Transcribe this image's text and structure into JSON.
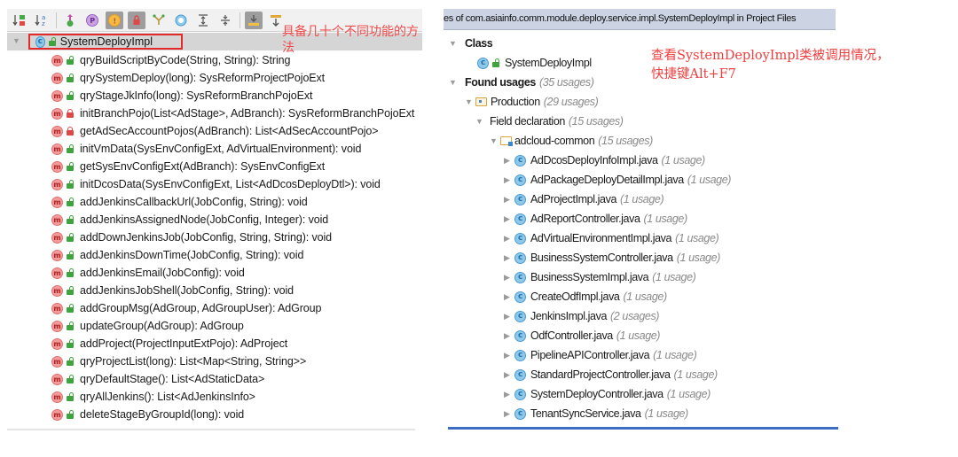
{
  "structure_panel": {
    "toolbar": [
      {
        "icon": "sort-by-visibility-icon",
        "glyph": "↓",
        "pressed": false
      },
      {
        "icon": "sort-alphabetically-icon",
        "glyph": "↓",
        "pressed": false
      },
      {
        "icon": "show-inherited-icon",
        "glyph": "↑",
        "pressed": false
      },
      {
        "icon": "show-properties-icon",
        "glyph": "P",
        "pressed": false
      },
      {
        "icon": "show-fields-icon",
        "glyph": "f",
        "pressed": true
      },
      {
        "icon": "show-non-public-icon",
        "glyph": "a",
        "pressed": true
      },
      {
        "icon": "show-lambdas-icon",
        "glyph": "Y",
        "pressed": false
      },
      {
        "icon": "show-anonymous-classes-icon",
        "glyph": "○",
        "pressed": false
      },
      {
        "icon": "expand-all-icon",
        "glyph": "≡",
        "pressed": false
      },
      {
        "icon": "collapse-all-icon",
        "glyph": "≑",
        "pressed": false
      },
      {
        "icon": "autoscroll-to-source-icon",
        "glyph": "⤓",
        "pressed": true
      },
      {
        "icon": "autoscroll-from-source-icon",
        "glyph": "⤒",
        "pressed": false
      }
    ],
    "root": {
      "label": "SystemDeployImpl",
      "kind": "class",
      "access": "public"
    },
    "methods": [
      {
        "label": "qryBuildScriptByCode(String, String): String",
        "access": "public"
      },
      {
        "label": "qrySystemDeploy(long): SysReformProjectPojoExt",
        "access": "public"
      },
      {
        "label": "qryStageJkInfo(long): SysReformBranchPojoExt",
        "access": "public"
      },
      {
        "label": "initBranchPojo(List<AdStage>, AdBranch): SysReformBranchPojoExt",
        "access": "private"
      },
      {
        "label": "getAdSecAccountPojos(AdBranch): List<AdSecAccountPojo>",
        "access": "private"
      },
      {
        "label": "initVmData(SysEnvConfigExt, AdVirtualEnvironment): void",
        "access": "public"
      },
      {
        "label": "getSysEnvConfigExt(AdBranch): SysEnvConfigExt",
        "access": "public"
      },
      {
        "label": "initDcosData(SysEnvConfigExt, List<AdDcosDeployDtl>): void",
        "access": "public"
      },
      {
        "label": "addJenkinsCallbackUrl(JobConfig, String): void",
        "access": "public"
      },
      {
        "label": "addJenkinsAssignedNode(JobConfig, Integer): void",
        "access": "public"
      },
      {
        "label": "addDownJenkinsJob(JobConfig, String, String): void",
        "access": "public"
      },
      {
        "label": "addJenkinsDownTime(JobConfig, String): void",
        "access": "public"
      },
      {
        "label": "addJenkinsEmail(JobConfig): void",
        "access": "public"
      },
      {
        "label": "addJenkinsJobShell(JobConfig, String): void",
        "access": "public"
      },
      {
        "label": "addGroupMsg(AdGroup, AdGroupUser): AdGroup",
        "access": "public"
      },
      {
        "label": "updateGroup(AdGroup): AdGroup",
        "access": "public"
      },
      {
        "label": "addProject(ProjectInputExtPojo): AdProject",
        "access": "public"
      },
      {
        "label": "qryProjectList(long): List<Map<String, String>>",
        "access": "public"
      },
      {
        "label": "qryDefaultStage(): List<AdStaticData>",
        "access": "public"
      },
      {
        "label": "qryAllJenkins(): List<AdJenkinsInfo>",
        "access": "public"
      },
      {
        "label": "deleteStageByGroupId(long): void",
        "access": "public"
      }
    ],
    "annotation": "具备几十个不同功能的方法"
  },
  "usages_panel": {
    "header": "es of com.asiainfo.comm.module.deploy.service.impl.SystemDeployImpl in Project Files",
    "class_group": {
      "label": "Class",
      "item": "SystemDeployImpl"
    },
    "found": {
      "label": "Found usages",
      "count": "(35 usages)"
    },
    "production": {
      "label": "Production",
      "count": "(29 usages)"
    },
    "field_declaration": {
      "label": "Field declaration",
      "count": "(15 usages)"
    },
    "module": {
      "label": "adcloud-common",
      "count": "(15 usages)"
    },
    "files": [
      {
        "name": "AdDcosDeployInfoImpl.java",
        "count": "(1 usage)"
      },
      {
        "name": "AdPackageDeployDetailImpl.java",
        "count": "(1 usage)"
      },
      {
        "name": "AdProjectImpl.java",
        "count": "(1 usage)"
      },
      {
        "name": "AdReportController.java",
        "count": "(1 usage)"
      },
      {
        "name": "AdVirtualEnvironmentImpl.java",
        "count": "(1 usage)"
      },
      {
        "name": "BusinessSystemController.java",
        "count": "(1 usage)"
      },
      {
        "name": "BusinessSystemImpl.java",
        "count": "(1 usage)"
      },
      {
        "name": "CreateOdfImpl.java",
        "count": "(1 usage)"
      },
      {
        "name": "JenkinsImpl.java",
        "count": "(2 usages)"
      },
      {
        "name": "OdfController.java",
        "count": "(1 usage)"
      },
      {
        "name": "PipelineAPIController.java",
        "count": "(1 usage)"
      },
      {
        "name": "StandardProjectController.java",
        "count": "(1 usage)"
      },
      {
        "name": "SystemDeployController.java",
        "count": "(1 usage)"
      },
      {
        "name": "TenantSyncService.java",
        "count": "(1 usage)"
      }
    ],
    "annotation_line1": "查看SystemDeployImpl类被调用情况，",
    "annotation_line2": "快捷键Alt+F7"
  },
  "colors": {
    "annotation_red": "#ef3e3e",
    "highlight_box": "#e32a2a",
    "usages_header_bg": "#ccd4e4",
    "bottom_accent": "#3c6fc4"
  }
}
